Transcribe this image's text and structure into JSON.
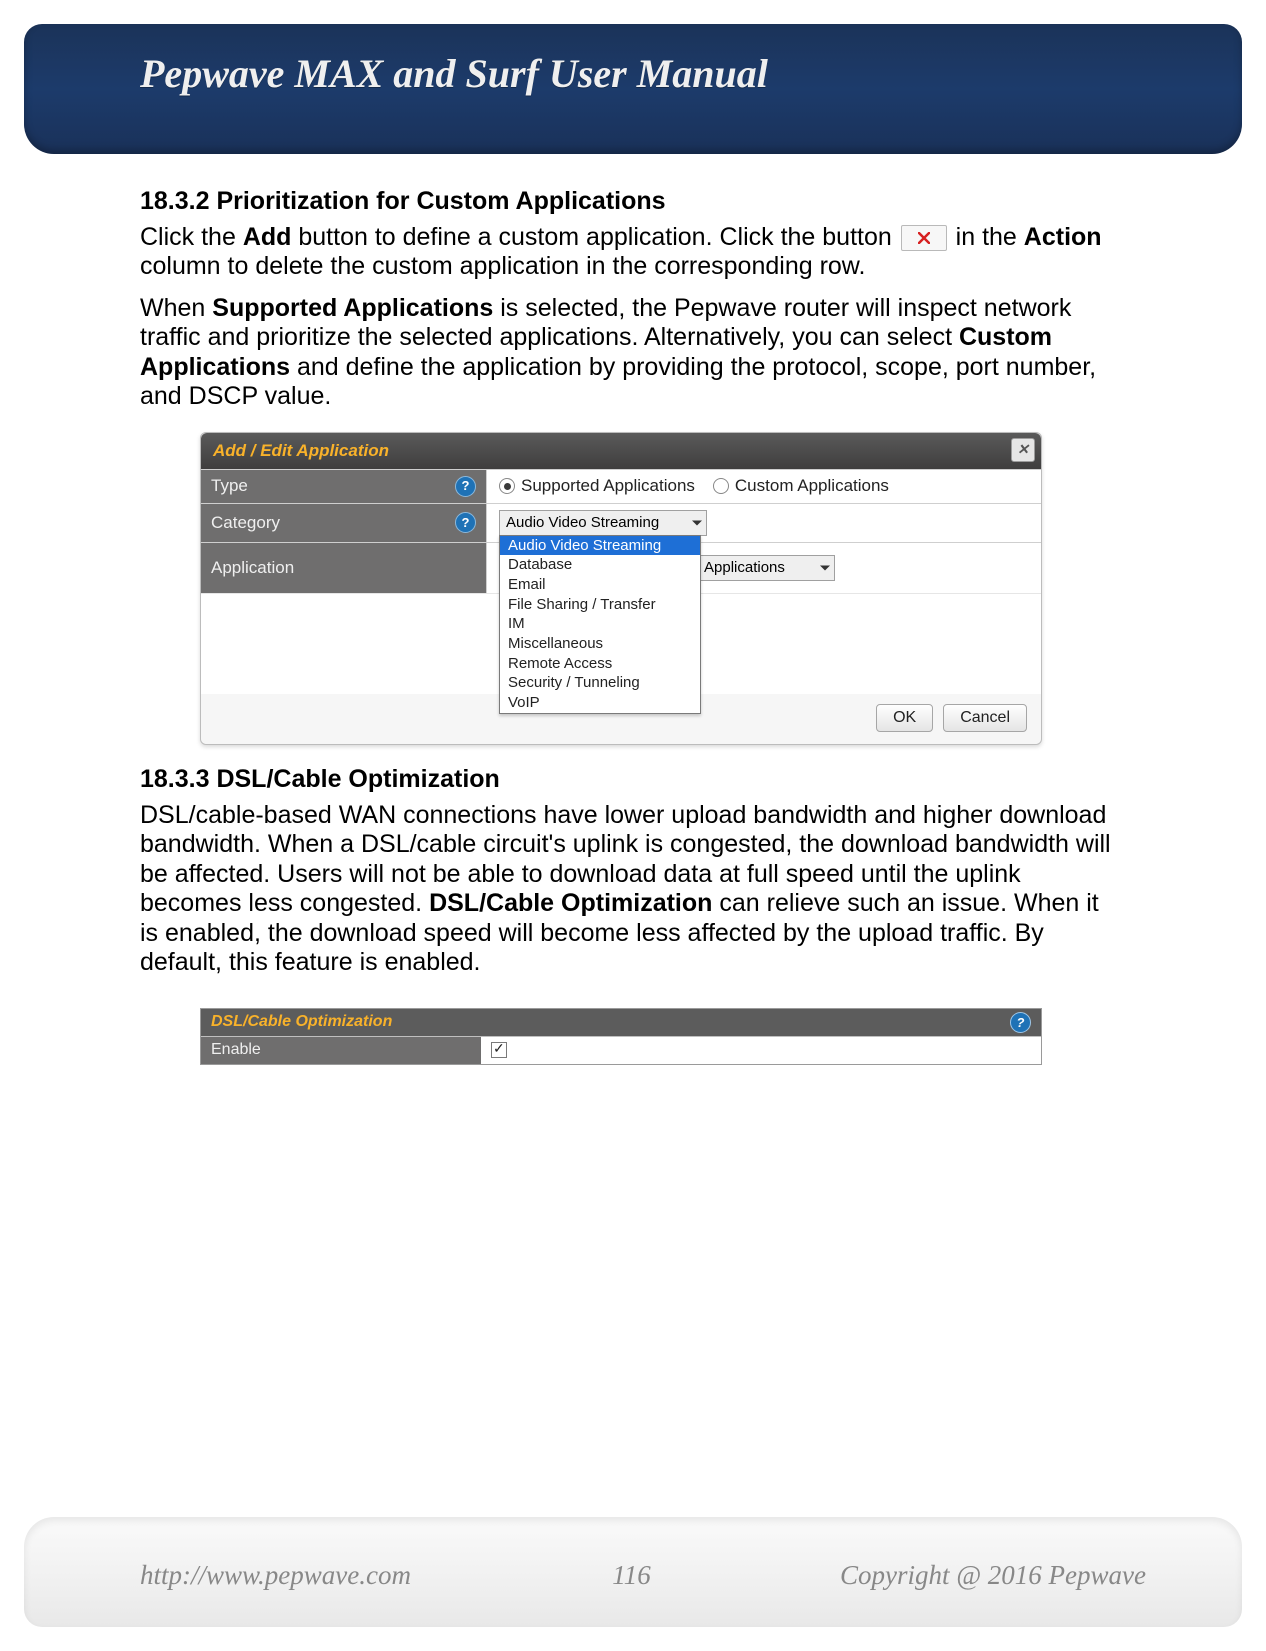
{
  "header": {
    "title": "Pepwave MAX and Surf User Manual"
  },
  "section1": {
    "heading": "18.3.2 Prioritization for Custom Applications",
    "p1_a": "Click the ",
    "p1_b_bold": "Add",
    "p1_c": " button to define a custom application. Click the button ",
    "p1_d": " in the ",
    "p1_e_bold": "Action",
    "p1_f": " column to delete the custom application in the corresponding row.",
    "p2_a": "When ",
    "p2_b_bold": "Supported Applications",
    "p2_c": " is selected, the Pepwave router will inspect network traffic and prioritize the selected applications. Alternatively, you can select ",
    "p2_d_bold": "Custom Applications",
    "p2_e": " and define the application by providing the protocol, scope, port number, and DSCP value."
  },
  "modal": {
    "title": "Add / Edit Application",
    "rows": {
      "type": {
        "label": "Type",
        "opt1": "Supported Applications",
        "opt2": "Custom Applications"
      },
      "category": {
        "label": "Category",
        "selected": "Audio Video Streaming",
        "options": [
          "Audio Video Streaming",
          "Database",
          "Email",
          "File Sharing / Transfer",
          "IM",
          "Miscellaneous",
          "Remote Access",
          "Security / Tunneling",
          "VoIP"
        ]
      },
      "application": {
        "label": "Application",
        "selected": "Applications"
      }
    },
    "buttons": {
      "ok": "OK",
      "cancel": "Cancel"
    },
    "help": "?"
  },
  "section2": {
    "heading": "18.3.3 DSL/Cable Optimization",
    "p_a": "DSL/cable-based WAN connections have lower upload bandwidth and higher download bandwidth. When a DSL/cable circuit's uplink is congested, the download bandwidth will be affected. Users will not be able to download data at full speed until the uplink becomes less congested. ",
    "p_b_bold": "DSL/Cable Optimization",
    "p_c": " can relieve such an issue. When it is enabled, the download speed will become less affected by the upload traffic. By default, this feature is enabled."
  },
  "dsl_panel": {
    "title": "DSL/Cable Optimization",
    "enable_label": "Enable",
    "help": "?"
  },
  "footer": {
    "url": "http://www.pepwave.com",
    "page": "116",
    "copyright": "Copyright @ 2016 Pepwave"
  }
}
